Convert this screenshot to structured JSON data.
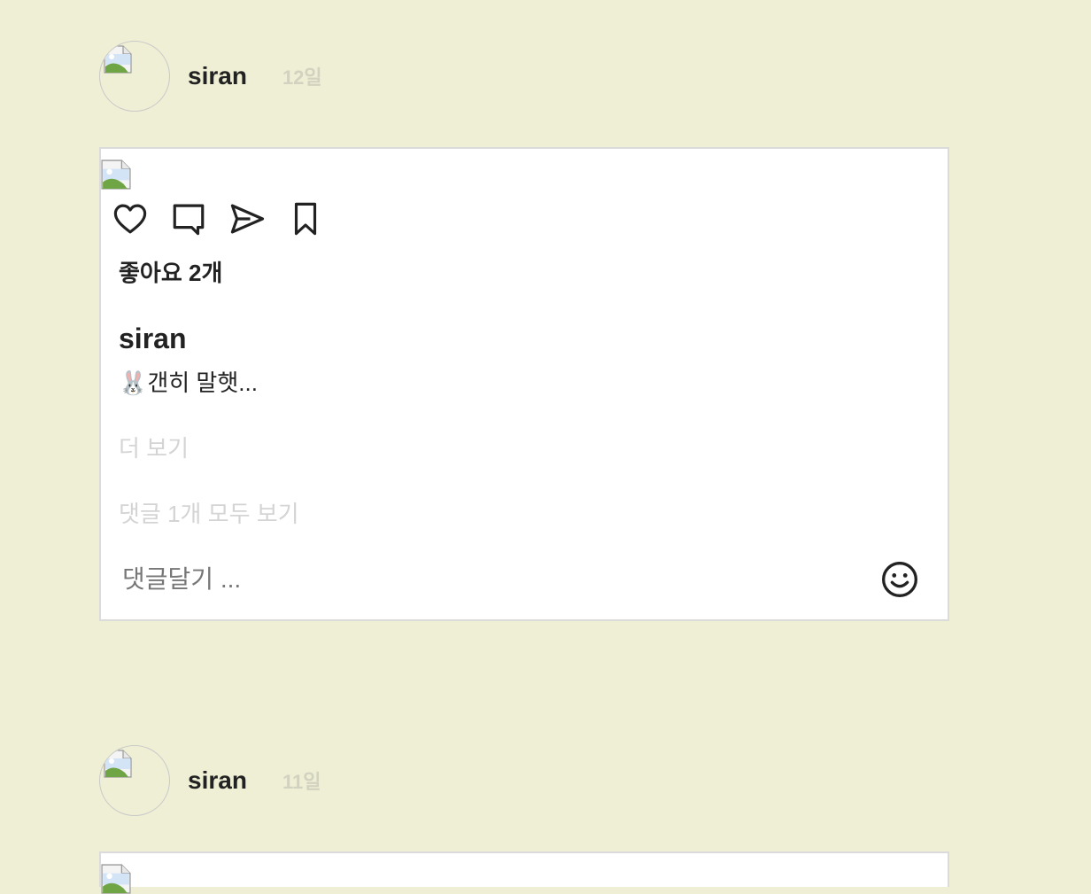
{
  "posts": [
    {
      "author": "siran",
      "time": "12일",
      "likes": "좋아요 2개",
      "caption_author": "siran",
      "caption": "🐰갠히 말햇...",
      "more_label": "더 보기",
      "comments_link": "댓글 1개 모두 보기",
      "comment_placeholder": "댓글달기 ..."
    },
    {
      "author": "siran",
      "time": "11일"
    }
  ],
  "icons": {
    "like": "heart-icon",
    "comment": "comment-icon",
    "share": "send-icon",
    "save": "bookmark-icon",
    "emoji": "smiley-icon"
  },
  "colors": {
    "background": "#efefd5",
    "card": "#ffffff",
    "muted_text": "#d4d4d4",
    "time_text": "#d2d2c0"
  }
}
